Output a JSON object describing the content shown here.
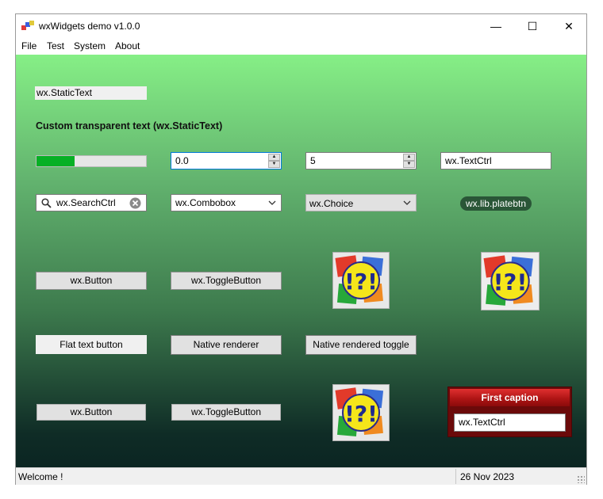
{
  "window": {
    "title": "wxWidgets demo v1.0.0",
    "controls": {
      "minimize": "—",
      "maximize": "☐",
      "close": "✕"
    }
  },
  "menu": [
    "File",
    "Test",
    "System",
    "About"
  ],
  "static_text": "wx.StaticText",
  "transparent_text": "Custom transparent text (wx.StaticText)",
  "gauge": {
    "value": 0.35
  },
  "spin1": {
    "value": "0.0"
  },
  "spin2": {
    "value": "5"
  },
  "textctrl1": {
    "value": "wx.TextCtrl"
  },
  "search": {
    "value": "wx.SearchCtrl"
  },
  "combobox": {
    "value": "wx.Combobox"
  },
  "choice": {
    "value": "wx.Choice"
  },
  "platebtn": {
    "label": "wx.lib.platebtn"
  },
  "button1": {
    "label": "wx.Button"
  },
  "togglebutton1": {
    "label": "wx.ToggleButton"
  },
  "flat_button": {
    "label": "Flat text button"
  },
  "native_renderer": {
    "label": "Native renderer"
  },
  "native_toggle": {
    "label": "Native rendered toggle"
  },
  "button2": {
    "label": "wx.Button"
  },
  "togglebutton2": {
    "label": "wx.ToggleButton"
  },
  "caption_panel": {
    "caption": "First caption",
    "textctrl": "wx.TextCtrl"
  },
  "bitmap_text": "!?!",
  "status": {
    "left": "Welcome !",
    "right": "26 Nov 2023"
  },
  "colors": {
    "gauge_fill": "#06b025",
    "caption_red": "#b01515",
    "plate": "#2a5637"
  }
}
